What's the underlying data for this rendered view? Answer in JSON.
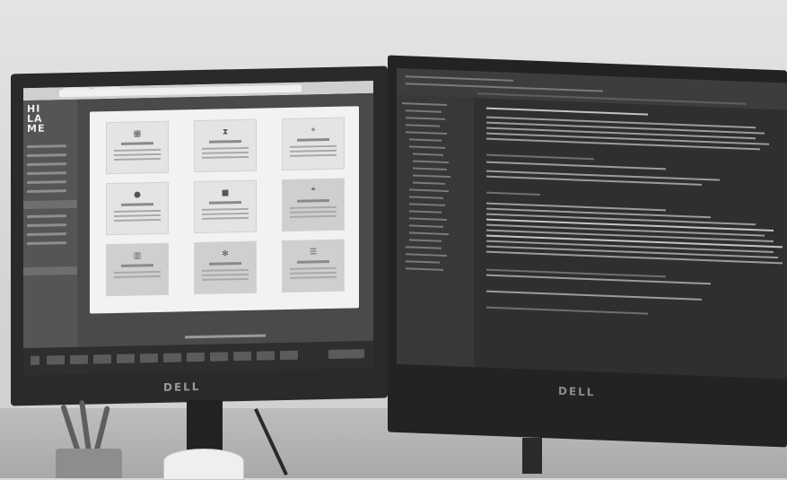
{
  "scene": {
    "left_monitor_brand": "DELL",
    "right_monitor_brand": "DELL",
    "app_logo": [
      "HI",
      "LA",
      "ME"
    ]
  },
  "left_screen": {
    "cards": [
      {
        "icon": "grid-icon",
        "dim": false
      },
      {
        "icon": "hourglass-icon",
        "dim": false
      },
      {
        "icon": "map-pin-icon",
        "dim": false
      },
      {
        "icon": "drop-icon",
        "dim": false
      },
      {
        "icon": "chat-icon",
        "dim": false
      },
      {
        "icon": "quote-icon",
        "dim": true
      },
      {
        "icon": "trash-icon",
        "dim": true
      },
      {
        "icon": "gear-icon",
        "dim": true
      },
      {
        "icon": "list-icon",
        "dim": true
      }
    ]
  },
  "colors": {
    "wall": "#d7d7d7",
    "desk": "#b0b0b0",
    "bezel": "#2a2a2a"
  }
}
